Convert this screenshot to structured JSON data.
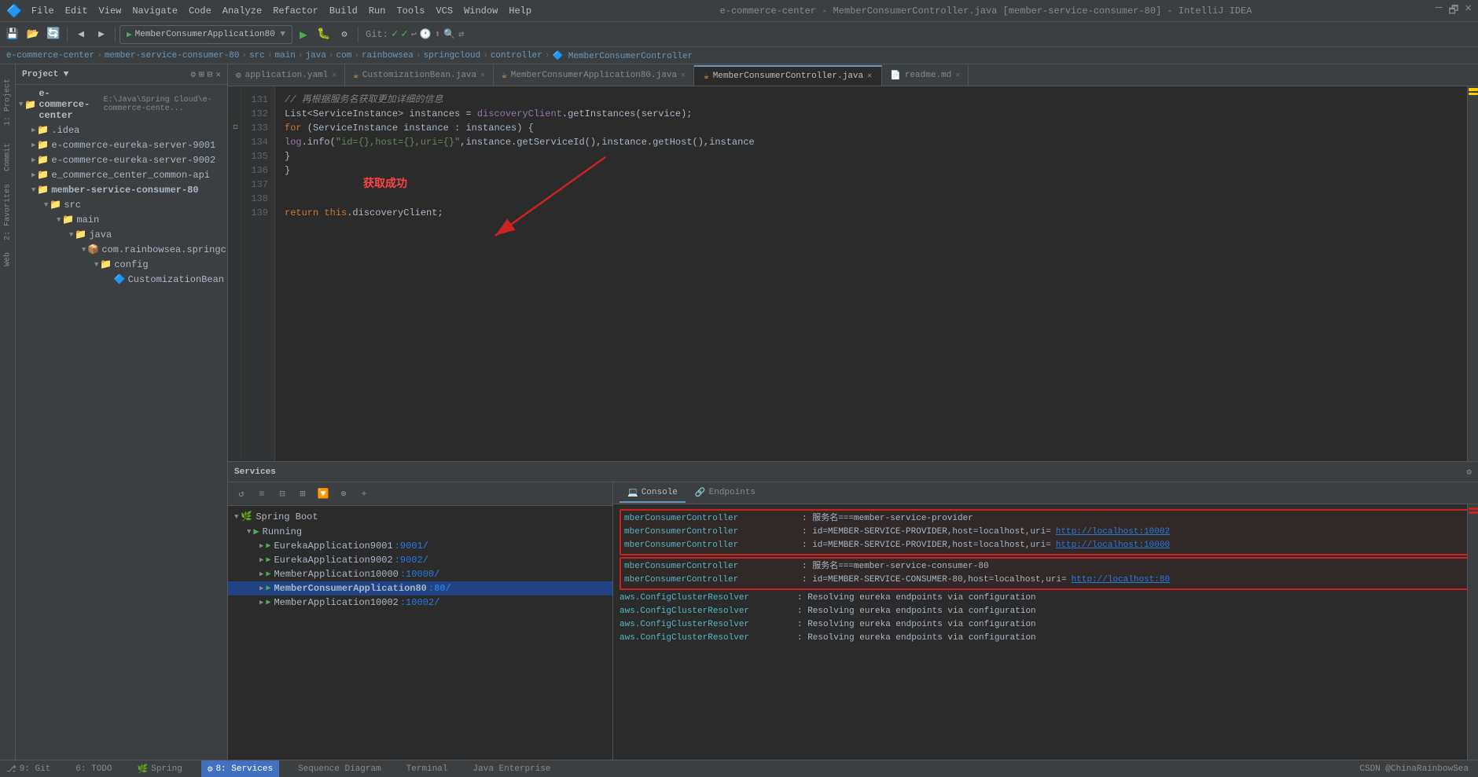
{
  "titleBar": {
    "appIcon": "🔷",
    "title": "e-commerce-center - MemberConsumerController.java [member-service-consumer-80] - IntelliJ IDEA",
    "menus": [
      "File",
      "Edit",
      "View",
      "Navigate",
      "Code",
      "Analyze",
      "Refactor",
      "Build",
      "Run",
      "Tools",
      "VCS",
      "Window",
      "Help"
    ],
    "winMin": "—",
    "winMax": "🗗",
    "winClose": "✕"
  },
  "toolbar": {
    "projectSelector": "MemberConsumerApplication80",
    "gitLabel": "Git:",
    "icons": [
      "💾",
      "⚙",
      "🔄",
      "◀",
      "▶",
      "🔍",
      "📋",
      "▶",
      "🐛",
      "⚙",
      "📊",
      "🔇",
      "⏪",
      "⏩",
      "🔄",
      "🔳",
      "⬛",
      "🔲",
      "🔴",
      "📂",
      "🔍",
      "🔤"
    ]
  },
  "breadcrumb": {
    "items": [
      "e-commerce-center",
      "member-service-consumer-80",
      "src",
      "main",
      "java",
      "com",
      "rainbowsea",
      "springcloud",
      "controller",
      "MemberConsumerController"
    ]
  },
  "projectPanel": {
    "title": "Project",
    "root": "e-commerce-center",
    "rootPath": "E:\\Java\\Spring Cloud\\e-commerce-cente...",
    "items": [
      {
        "label": ".idea",
        "type": "folder",
        "level": 1
      },
      {
        "label": "e-commerce-eureka-server-9001",
        "type": "folder",
        "level": 1
      },
      {
        "label": "e-commerce-eureka-server-9002",
        "type": "folder",
        "level": 1
      },
      {
        "label": "e_commerce_center_common-api",
        "type": "folder",
        "level": 1
      },
      {
        "label": "member-service-consumer-80",
        "type": "folder",
        "level": 1,
        "expanded": true
      },
      {
        "label": "src",
        "type": "folder",
        "level": 2,
        "expanded": true
      },
      {
        "label": "main",
        "type": "folder",
        "level": 3,
        "expanded": true
      },
      {
        "label": "java",
        "type": "folder",
        "level": 4,
        "expanded": true
      },
      {
        "label": "com.rainbowsea.springcloud",
        "type": "package",
        "level": 5,
        "expanded": true
      },
      {
        "label": "config",
        "type": "folder",
        "level": 6,
        "expanded": true
      },
      {
        "label": "CustomizationBean",
        "type": "java",
        "level": 7
      }
    ]
  },
  "tabs": [
    {
      "label": "application.yaml",
      "type": "yaml",
      "active": false
    },
    {
      "label": "CustomizationBean.java",
      "type": "java",
      "active": false
    },
    {
      "label": "MemberConsumerApplication80.java",
      "type": "java",
      "active": false
    },
    {
      "label": "MemberConsumerController.java",
      "type": "java",
      "active": true
    },
    {
      "label": "readme.md",
      "type": "md",
      "active": false
    }
  ],
  "codeLines": [
    {
      "num": 131,
      "content": "comment",
      "text": "        //  再根据服务名获取更加详细的信息"
    },
    {
      "num": 132,
      "content": "code",
      "parts": [
        {
          "t": "        List<ServiceInstance> instances = ",
          "c": "normal"
        },
        {
          "t": "discoveryClient",
          "c": "purple"
        },
        {
          "t": ".getInstances(service);",
          "c": "normal"
        }
      ]
    },
    {
      "num": 133,
      "content": "code",
      "parts": [
        {
          "t": "        ",
          "c": "normal"
        },
        {
          "t": "for",
          "c": "keyword"
        },
        {
          "t": " (ServiceInstance instance : instances) {",
          "c": "normal"
        }
      ]
    },
    {
      "num": 134,
      "content": "code",
      "parts": [
        {
          "t": "            log",
          "c": "normal"
        },
        {
          "t": ".info(\"id={},host={},uri={}\",instance.getServiceId(),instance.getHost(),instance...",
          "c": "string"
        }
      ]
    },
    {
      "num": 135,
      "content": "code",
      "parts": [
        {
          "t": "        }",
          "c": "normal"
        }
      ]
    },
    {
      "num": 136,
      "content": "code",
      "parts": [
        {
          "t": "    }",
          "c": "normal"
        }
      ]
    },
    {
      "num": 137,
      "content": "chinese",
      "text": "获取成功"
    },
    {
      "num": 138,
      "content": "empty"
    },
    {
      "num": 139,
      "content": "code",
      "parts": [
        {
          "t": "    ",
          "c": "normal"
        },
        {
          "t": "return",
          "c": "keyword"
        },
        {
          "t": " ",
          "c": "normal"
        },
        {
          "t": "this",
          "c": "keyword"
        },
        {
          "t": ".discoveryClient;",
          "c": "normal"
        }
      ]
    }
  ],
  "bottomPanel": {
    "title": "Services",
    "toolbar": {
      "icons": [
        "↺",
        "≡",
        "⊟",
        "⊞",
        "🔽",
        "⊛",
        "+"
      ]
    },
    "serviceTree": [
      {
        "label": "Spring Boot",
        "type": "springboot",
        "level": 0,
        "expanded": true
      },
      {
        "label": "Running",
        "type": "running",
        "level": 1,
        "expanded": true
      },
      {
        "label": "EurekaApplication9001",
        "port": ":9001/",
        "type": "running-app",
        "level": 2
      },
      {
        "label": "EurekaApplication9002",
        "port": ":9002/",
        "type": "running-app",
        "level": 2
      },
      {
        "label": "MemberApplication10000",
        "port": ":10000/",
        "type": "running-app",
        "level": 2
      },
      {
        "label": "MemberConsumerApplication80",
        "port": ":80/",
        "type": "running-app-selected",
        "level": 2,
        "selected": true
      },
      {
        "label": "MemberApplication10002",
        "port": ":10002/",
        "type": "running-app",
        "level": 2
      }
    ],
    "consoleTabs": [
      "Console",
      "Endpoints"
    ],
    "activeTab": "Console",
    "consoleLines": [
      {
        "class": "mberConsumerController",
        "msg": ": 服务名===member-service-provider",
        "highlight": true
      },
      {
        "class": "mberConsumerController",
        "msg": ": id=MEMBER-SERVICE-PROVIDER,host=localhost,uri=",
        "link": "http://localhost:10002",
        "highlight": true
      },
      {
        "class": "mberConsumerController",
        "msg": ": id=MEMBER-SERVICE-PROVIDER,host=localhost,uri=",
        "link": "http://localhost:10000",
        "highlight": true
      },
      {
        "class": "mberConsumerController",
        "msg": ": 服务名===member-service-consumer-80",
        "highlight2": true
      },
      {
        "class": "mberConsumerController",
        "msg": ": id=MEMBER-SERVICE-CONSUMER-80,host=localhost,uri=",
        "link": "http://localhost:80",
        "highlight2": true
      },
      {
        "class": "aws.ConfigClusterResolver",
        "msg": ": Resolving eureka endpoints via configuration"
      },
      {
        "class": "aws.ConfigClusterResolver",
        "msg": ": Resolving eureka endpoints via configuration"
      },
      {
        "class": "aws.ConfigClusterResolver",
        "msg": ": Resolving eureka endpoints via configuration"
      },
      {
        "class": "aws.ConfigClusterResolver",
        "msg": ": Resolving eureka endpoints via configuration"
      }
    ]
  },
  "statusBar": {
    "tabs": [
      {
        "label": "9: Git",
        "active": false
      },
      {
        "label": "6: TODO",
        "active": false
      },
      {
        "label": "Spring",
        "active": false
      },
      {
        "label": "8: Services",
        "active": true
      },
      {
        "label": "Sequence Diagram",
        "active": false
      },
      {
        "label": "Terminal",
        "active": false
      },
      {
        "label": "Java Enterprise",
        "active": false
      }
    ],
    "watermark": "CSDN @ChinaRainbowSea"
  },
  "colors": {
    "accent": "#6897bb",
    "active": "#214283",
    "tabActive": "#4272bf",
    "highlight1border": "#ff4444",
    "highlight2border": "#ff4444"
  }
}
